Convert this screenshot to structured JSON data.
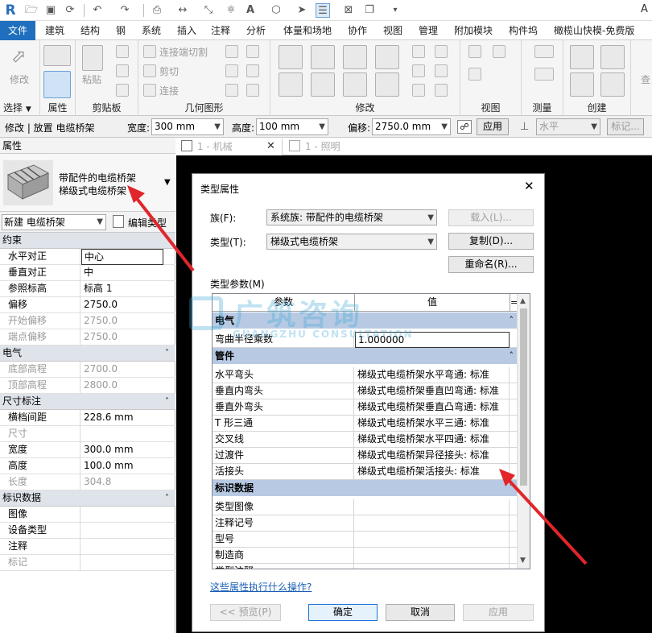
{
  "window": {
    "corner_label": "A"
  },
  "tabs": [
    {
      "label": "文件",
      "active": true
    },
    {
      "label": "建筑"
    },
    {
      "label": "结构"
    },
    {
      "label": "钢"
    },
    {
      "label": "系统"
    },
    {
      "label": "插入"
    },
    {
      "label": "注释"
    },
    {
      "label": "分析"
    },
    {
      "label": "体量和场地"
    },
    {
      "label": "协作"
    },
    {
      "label": "视图"
    },
    {
      "label": "管理"
    },
    {
      "label": "附加模块"
    },
    {
      "label": "构件坞"
    },
    {
      "label": "橄榄山快模-免费版"
    }
  ],
  "ribbon": {
    "groups": [
      "选择",
      "属性",
      "剪贴板",
      "几何图形",
      "修改",
      "视图",
      "测量",
      "创建"
    ],
    "modify_label": "修改",
    "paste_label": "粘贴",
    "connect_cut": "连接端切割",
    "cut": "剪切",
    "join": "连接",
    "right_partial": "查"
  },
  "options_bar": {
    "mode": "修改 | 放置 电缆桥架",
    "width_label": "宽度:",
    "width_value": "300 mm",
    "height_label": "高度:",
    "height_value": "100 mm",
    "offset_label": "偏移:",
    "offset_value": "2750.0 mm",
    "apply": "应用",
    "horizontal": "水平",
    "tag": "标记..."
  },
  "properties": {
    "title": "属性",
    "type_line1": "带配件的电缆桥架",
    "type_line2": "梯级式电缆桥架",
    "instance_selector": "新建 电缆桥架",
    "edit_type": "编辑类型",
    "sections": [
      {
        "name": "约束",
        "rows": [
          {
            "name": "水平对正",
            "value": "中心"
          },
          {
            "name": "垂直对正",
            "value": "中"
          },
          {
            "name": "参照标高",
            "value": "标高 1"
          },
          {
            "name": "偏移",
            "value": "2750.0"
          },
          {
            "name": "开始偏移",
            "value": "2750.0",
            "disabled": true
          },
          {
            "name": "端点偏移",
            "value": "2750.0",
            "disabled": true
          }
        ]
      },
      {
        "name": "电气",
        "rows": [
          {
            "name": "底部高程",
            "value": "2700.0",
            "disabled": true
          },
          {
            "name": "顶部高程",
            "value": "2800.0",
            "disabled": true
          }
        ]
      },
      {
        "name": "尺寸标注",
        "rows": [
          {
            "name": "横档间距",
            "value": "228.6 mm"
          },
          {
            "name": "尺寸",
            "value": "",
            "disabled": true
          },
          {
            "name": "宽度",
            "value": "300.0 mm"
          },
          {
            "name": "高度",
            "value": "100.0 mm"
          },
          {
            "name": "长度",
            "value": "304.8",
            "disabled": true
          }
        ]
      },
      {
        "name": "标识数据",
        "rows": [
          {
            "name": "图像",
            "value": ""
          },
          {
            "name": "设备类型",
            "value": ""
          },
          {
            "name": "注释",
            "value": ""
          },
          {
            "name": "标记",
            "value": "",
            "disabled": true
          }
        ]
      }
    ]
  },
  "view_tabs": [
    {
      "label": "1 - 机械"
    },
    {
      "label": "1 - 照明"
    }
  ],
  "dialog": {
    "title": "类型属性",
    "family_label": "族(F):",
    "family_value": "系统族: 带配件的电缆桥架",
    "type_label": "类型(T):",
    "type_value": "梯级式电缆桥架",
    "load": "载入(L)...",
    "duplicate": "复制(D)...",
    "rename": "重命名(R)...",
    "params_label": "类型参数(M)",
    "col_param": "参数",
    "col_value": "值",
    "col_eq": "=",
    "groups": [
      {
        "name": "电气",
        "rows": [
          {
            "name": "弯曲半径乘数",
            "value": "1.000000",
            "editing": true
          }
        ]
      },
      {
        "name": "管件",
        "rows": [
          {
            "name": "水平弯头",
            "value": "梯级式电缆桥架水平弯通: 标准"
          },
          {
            "name": "垂直内弯头",
            "value": "梯级式电缆桥架垂直凹弯通: 标准"
          },
          {
            "name": "垂直外弯头",
            "value": "梯级式电缆桥架垂直凸弯通: 标准"
          },
          {
            "name": "T 形三通",
            "value": "梯级式电缆桥架水平三通: 标准"
          },
          {
            "name": "交叉线",
            "value": "梯级式电缆桥架水平四通: 标准"
          },
          {
            "name": "过渡件",
            "value": "梯级式电缆桥架异径接头: 标准"
          },
          {
            "name": "活接头",
            "value": "梯级式电缆桥架活接头: 标准"
          }
        ]
      },
      {
        "name": "标识数据",
        "rows": [
          {
            "name": "类型图像",
            "value": ""
          },
          {
            "name": "注释记号",
            "value": ""
          },
          {
            "name": "型号",
            "value": ""
          },
          {
            "name": "制造商",
            "value": ""
          },
          {
            "name": "类型注释",
            "value": ""
          }
        ]
      }
    ],
    "help_link": "这些属性执行什么操作?",
    "preview": "<< 预览(P)",
    "ok": "确定",
    "cancel": "取消",
    "apply": "应用"
  },
  "watermark": {
    "main": "广筑咨询",
    "sub": "GUANGZHU CONSULTATION"
  },
  "colors": {
    "accent": "#1f6fbe",
    "annotation_arrow": "#e0262a",
    "category_bg": "#b8cae3"
  }
}
